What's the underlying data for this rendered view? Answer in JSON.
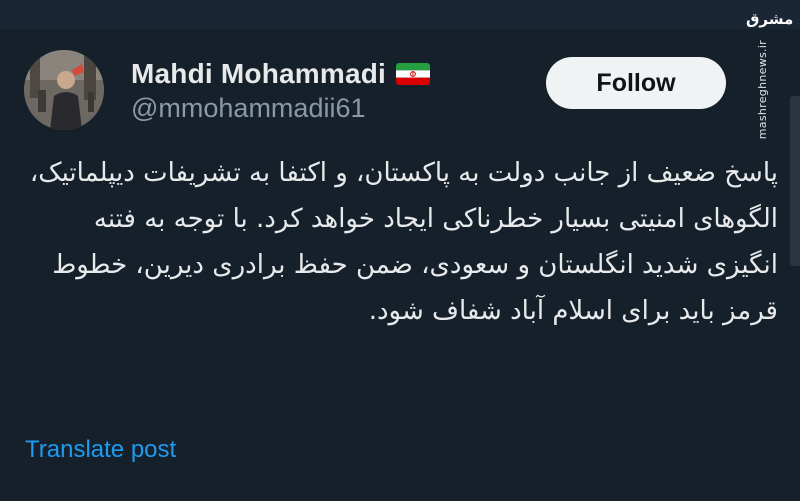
{
  "tweet": {
    "author": {
      "display_name": "Mahdi Mohammadi",
      "handle": "@mmohammadii61",
      "flag_icon": "iran-flag-icon",
      "avatar_icon": "profile-avatar"
    },
    "follow_label": "Follow",
    "text": "پاسخ ضعیف از جانب دولت به پاکستان، و اکتفا به تشریفات دیپلماتیک، الگوهای امنیتی بسیار خطرناکی ایجاد خواهد کرد. با توجه به فتنه انگیزی شدید انگلستان و سعودی، ضمن حفظ برادری دیرین، خطوط قرمز باید برای اسلام آباد شفاف شود.",
    "translate_label": "Translate post"
  },
  "watermark": {
    "logo_text": "مشرق",
    "url_text": "mashreghnews.ir"
  },
  "colors": {
    "background": "#15202b",
    "primary_text": "#e7e9ea",
    "secondary_text": "#8b98a5",
    "link": "#1d9bf0",
    "button_bg": "#eff3f4",
    "button_text": "#0f1419"
  }
}
